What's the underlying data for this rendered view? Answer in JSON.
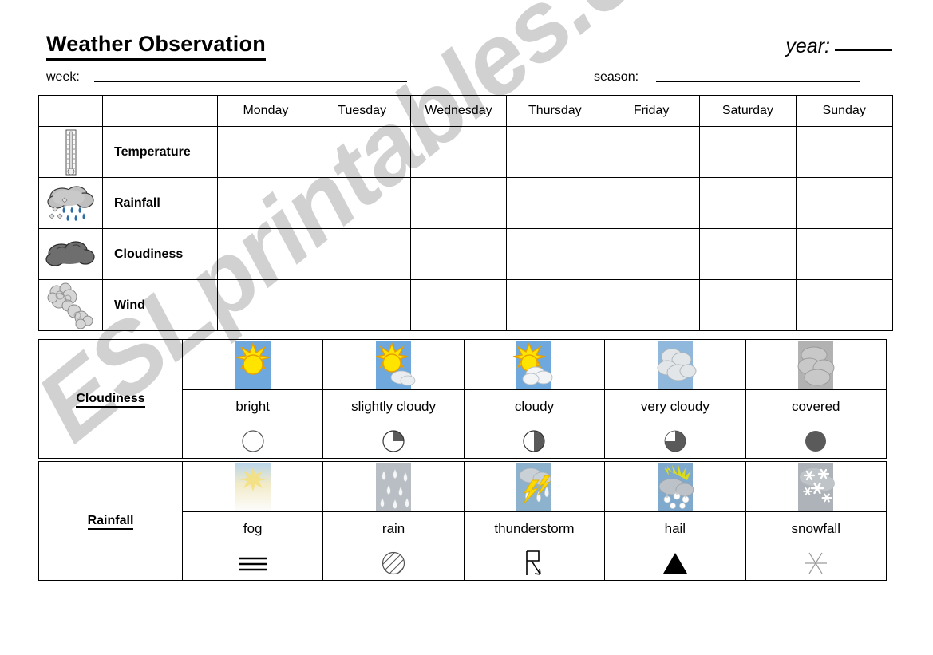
{
  "header": {
    "title": "Weather Observation",
    "year_label": "year:",
    "week_label": "week:",
    "season_label": "season:"
  },
  "main_table": {
    "days": [
      "Monday",
      "Tuesday",
      "Wednesday",
      "Thursday",
      "Friday",
      "Saturday",
      "Sunday"
    ],
    "rows": [
      {
        "label": "Temperature",
        "icon": "thermometer-icon"
      },
      {
        "label": "Rainfall",
        "icon": "rain-cloud-icon"
      },
      {
        "label": "Cloudiness",
        "icon": "dark-cloud-icon"
      },
      {
        "label": "Wind",
        "icon": "wind-cloud-icon"
      }
    ]
  },
  "cloudiness_legend": {
    "title": "Cloudiness",
    "items": [
      {
        "word": "bright",
        "picture": "sun-picture",
        "symbol": "circle-empty-icon"
      },
      {
        "word": "slightly cloudy",
        "picture": "sun-small-cloud-picture",
        "symbol": "circle-quarter-icon"
      },
      {
        "word": "cloudy",
        "picture": "sun-cloud-picture",
        "symbol": "circle-half-icon"
      },
      {
        "word": "very cloudy",
        "picture": "clouds-picture",
        "symbol": "circle-three-quarter-icon"
      },
      {
        "word": "covered",
        "picture": "grey-overcast-picture",
        "symbol": "circle-full-icon"
      }
    ]
  },
  "rainfall_legend": {
    "title": "Rainfall",
    "items": [
      {
        "word": "fog",
        "picture": "fog-picture",
        "symbol": "fog-lines-icon"
      },
      {
        "word": "rain",
        "picture": "raindrops-picture",
        "symbol": "hatched-circle-icon"
      },
      {
        "word": "thunderstorm",
        "picture": "lightning-picture",
        "symbol": "lightning-arrow-icon"
      },
      {
        "word": "hail",
        "picture": "hail-picture",
        "symbol": "filled-triangle-icon"
      },
      {
        "word": "snowfall",
        "picture": "snowflakes-picture",
        "symbol": "snow-asterisk-icon"
      }
    ]
  },
  "watermark": {
    "text": "ESLprintables.com"
  },
  "colors": {
    "sky": "#6FA8DC",
    "sun": "#FFE400",
    "sun_outline": "#E8A000",
    "cloud_light": "#E8E8E8",
    "cloud_grey": "#A8A8A8",
    "cloud_dark": "#6E6E6E",
    "rain_blue": "#2E6DA4",
    "symbol_fill": "#5A5A5A",
    "line": "#000000"
  }
}
